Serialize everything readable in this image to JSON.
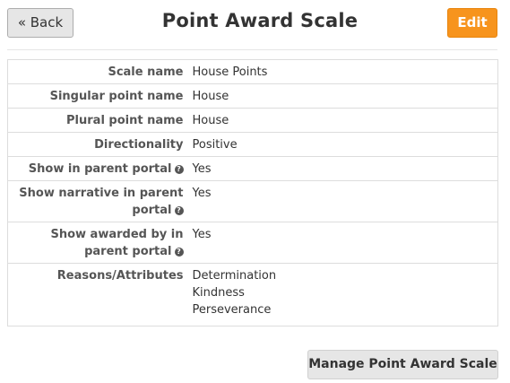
{
  "header": {
    "back_label": "« Back",
    "title": "Point Award Scale",
    "edit_label": "Edit"
  },
  "details": {
    "scale_name": {
      "label": "Scale name",
      "value": "House Points"
    },
    "singular": {
      "label": "Singular point name",
      "value": "House"
    },
    "plural": {
      "label": "Plural point name",
      "value": "House"
    },
    "directionality": {
      "label": "Directionality",
      "value": "Positive"
    },
    "show_parent_portal": {
      "label": "Show in parent portal",
      "value": "Yes"
    },
    "show_narrative": {
      "label": "Show narrative in parent portal",
      "value": "Yes"
    },
    "show_awarded_by": {
      "label": "Show awarded by in parent portal",
      "value": "Yes"
    },
    "reasons": {
      "label": "Reasons/Attributes",
      "values": [
        "Determination",
        "Kindness",
        "Perseverance"
      ]
    }
  },
  "footer": {
    "manage_label": "Manage Point Award Scale »"
  },
  "colors": {
    "edit_button": "#f7941d",
    "secondary_button": "#e6e6e6",
    "border": "#dddddd"
  },
  "icons": {
    "help": "question-circle-icon"
  }
}
